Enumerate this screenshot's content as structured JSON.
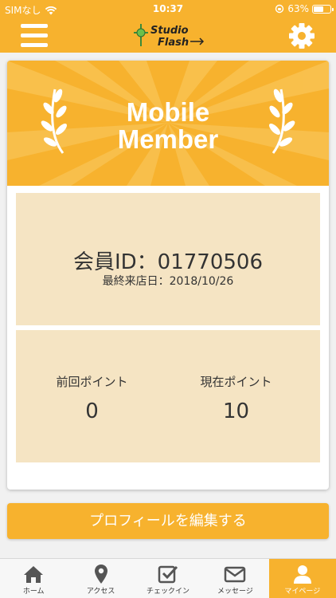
{
  "status_bar": {
    "carrier": "SIMなし",
    "time": "10:37",
    "battery": "63%",
    "battery_level": 0.63
  },
  "header": {
    "menu_icon": "hamburger-menu-icon",
    "logo_text_line1": "Studio",
    "logo_text_line2": "Flash",
    "settings_icon": "gear-icon"
  },
  "card": {
    "banner_title_line1": "Mobile",
    "banner_title_line2": "Member",
    "member_id_label": "会員ID：01770506",
    "last_visit": "最終来店日：2018/10/26",
    "previous_points_label": "前回ポイント",
    "previous_points_value": "0",
    "current_points_label": "現在ポイント",
    "current_points_value": "10"
  },
  "edit_profile_label": "プロフィールを編集する",
  "tabs": [
    {
      "label": "ホーム",
      "icon": "home-icon",
      "active": false
    },
    {
      "label": "アクセス",
      "icon": "map-pin-icon",
      "active": false
    },
    {
      "label": "チェックイン",
      "icon": "checkin-icon",
      "active": false
    },
    {
      "label": "メッセージ",
      "icon": "mail-icon",
      "active": false
    },
    {
      "label": "マイページ",
      "icon": "user-icon",
      "active": true
    }
  ],
  "colors": {
    "accent": "#f7b22e",
    "panel": "#f5e4c3"
  }
}
